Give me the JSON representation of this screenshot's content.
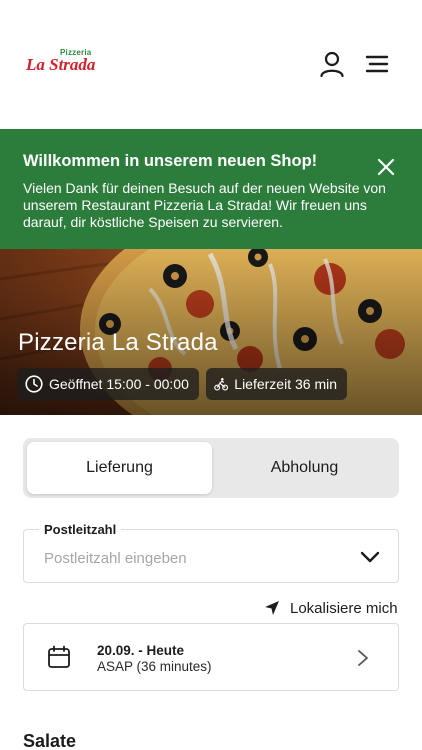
{
  "header": {
    "logo_top": "Pizzeria",
    "logo_main": "La Strada",
    "user_icon": "user-icon",
    "menu_icon": "hamburger-menu-icon"
  },
  "banner": {
    "title": "Willkommen in unserem neuen Shop!",
    "text": "Vielen Dank für deinen Besuch auf der neuen Website von unserem Restaurant Pizzeria La Strada! Wir freuen uns darauf, dir köstliche Speisen zu servieren.",
    "close_icon": "close-icon",
    "background": "#2c7d3c"
  },
  "hero": {
    "restaurant_name": "Pizzeria La Strada",
    "opening_hours": "Geöffnet 15:00 - 00:00",
    "delivery_time": "Lieferzeit 36 min"
  },
  "order_mode": {
    "delivery_label": "Lieferung",
    "pickup_label": "Abholung",
    "selected": "Lieferung"
  },
  "postcode": {
    "label": "Postleitzahl",
    "placeholder": "Postleitzahl eingeben"
  },
  "locate": {
    "label": "Lokalisiere mich"
  },
  "schedule": {
    "date_label": "20.09. - Heute",
    "time_label": "ASAP (36 minutes)"
  },
  "menu": {
    "first_section": "Salate"
  }
}
